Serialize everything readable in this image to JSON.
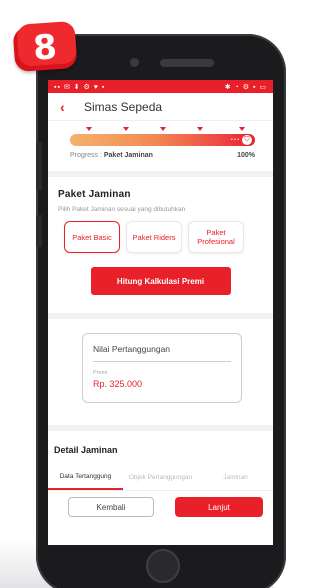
{
  "badge": {
    "number": "8"
  },
  "statusbar": {
    "left": "▪▪ ✉ ⬇ ⚙ ♥ ▪",
    "right": "✱ ◔ ⚙ ▪ ▭"
  },
  "appbar": {
    "back_icon": "chevron-left-icon",
    "title": "Simas Sepeda"
  },
  "progress": {
    "value_percent": 100,
    "label_prefix": "Progress :",
    "label_step": "Paket Jaminan",
    "label_value": "100%",
    "markers": [
      0.1,
      0.3,
      0.5,
      0.7,
      0.93
    ]
  },
  "package": {
    "title": "Paket Jaminan",
    "subtitle": "Pilih Paket Jaminan sesuai yang dibutuhkan",
    "options": [
      "Paket Basic",
      "Paket Riders",
      "Paket Profesional"
    ],
    "selected": "Paket Basic",
    "cta": "Hitung Kalkulasi Premi"
  },
  "coverage": {
    "label": "Nilai Pertanggungan",
    "premi_label": "Premi",
    "premi_value": "Rp. 325.000"
  },
  "detail": {
    "title": "Detail Jaminan",
    "tabs": [
      "Data Tertanggung",
      "Objek Pertanggungan",
      "Jaminan"
    ],
    "active_tab": "Data Tertanggung"
  },
  "footer": {
    "back": "Kembali",
    "next": "Lanjut"
  },
  "colors": {
    "primary": "#e8202a",
    "gradient_start": "#f5b26b",
    "gradient_end": "#e8202a"
  }
}
